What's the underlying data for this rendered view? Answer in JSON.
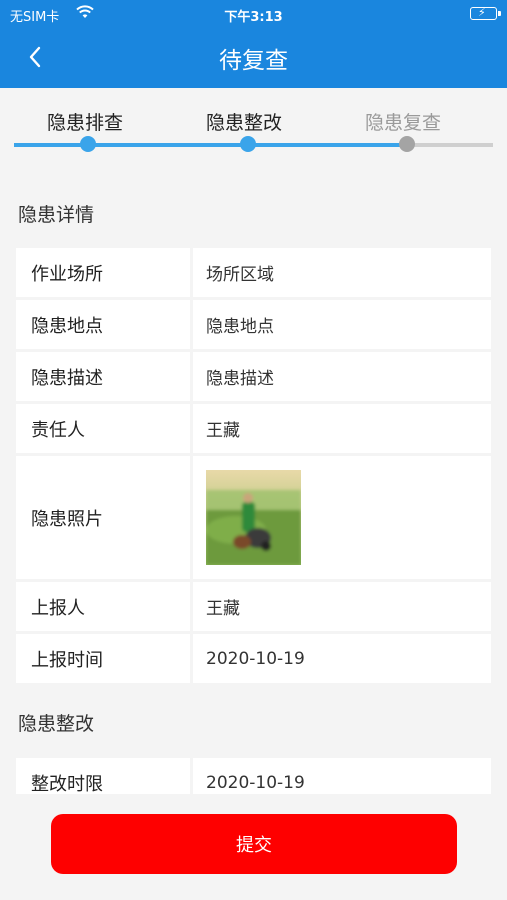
{
  "status_bar": {
    "carrier": "无SIM卡",
    "time": "下午3:13"
  },
  "nav": {
    "title": "待复查",
    "back_icon": "chevron-left-icon"
  },
  "steps": [
    {
      "label": "隐患排查",
      "state": "done"
    },
    {
      "label": "隐患整改",
      "state": "done"
    },
    {
      "label": "隐患复查",
      "state": "pending"
    }
  ],
  "sections": {
    "detail_title": "隐患详情",
    "rectify_title": "隐患整改"
  },
  "detail_rows": [
    {
      "label": "作业场所",
      "value": "场所区域"
    },
    {
      "label": "隐患地点",
      "value": "隐患地点"
    },
    {
      "label": "隐患描述",
      "value": "隐患描述"
    },
    {
      "label": "责任人",
      "value": "王藏"
    },
    {
      "label": "隐患照片",
      "value": ""
    },
    {
      "label": "上报人",
      "value": "王藏"
    },
    {
      "label": "上报时间",
      "value": "2020-10-19"
    }
  ],
  "rectify_rows": [
    {
      "label": "整改时限",
      "value": "2020-10-19"
    }
  ],
  "submit_label": "提交",
  "colors": {
    "nav_blue": "#1a86de",
    "step_active": "#3aa4ea",
    "step_inactive": "#a4a4a4",
    "submit_red": "#fe0000"
  }
}
